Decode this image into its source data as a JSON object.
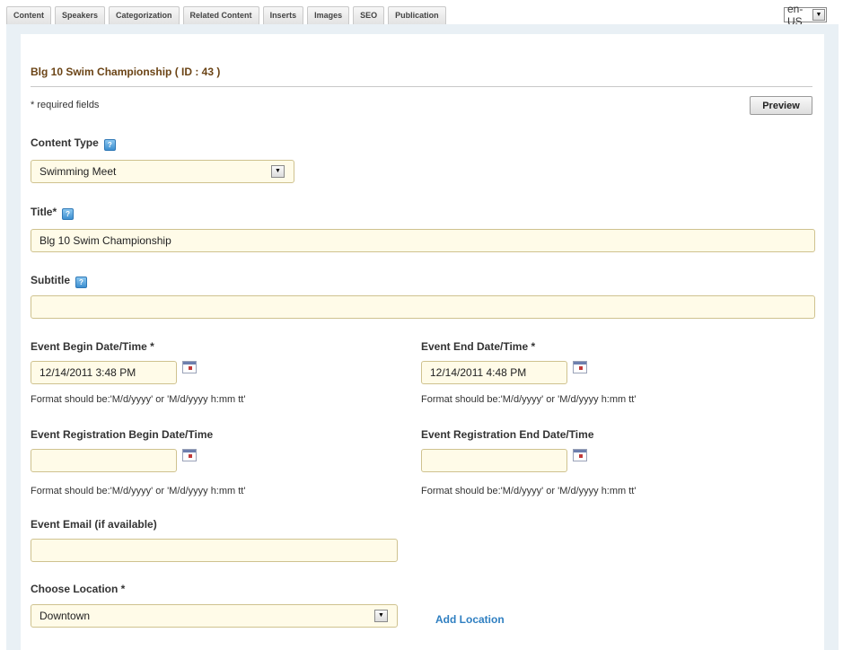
{
  "tabs": [
    "Content",
    "Speakers",
    "Categorization",
    "Related Content",
    "Inserts",
    "Images",
    "SEO",
    "Publication"
  ],
  "language": {
    "selected": "en-US"
  },
  "page": {
    "title": "Blg 10 Swim Championship ( ID : 43 )"
  },
  "required_note": "* required fields",
  "preview_label": "Preview",
  "help_glyph": "?",
  "content_type": {
    "label": "Content Type",
    "value": "Swimming Meet"
  },
  "title_field": {
    "label": "Title*",
    "value": "Blg 10 Swim Championship"
  },
  "subtitle_field": {
    "label": "Subtitle",
    "value": ""
  },
  "event_begin": {
    "label": "Event Begin Date/Time *",
    "value": "12/14/2011 3:48 PM",
    "hint": "Format should be:'M/d/yyyy' or 'M/d/yyyy h:mm tt'"
  },
  "event_end": {
    "label": "Event End Date/Time *",
    "value": "12/14/2011 4:48 PM",
    "hint": "Format should be:'M/d/yyyy' or 'M/d/yyyy h:mm tt'"
  },
  "reg_begin": {
    "label": "Event Registration Begin Date/Time",
    "value": "",
    "hint": "Format should be:'M/d/yyyy' or 'M/d/yyyy h:mm tt'"
  },
  "reg_end": {
    "label": "Event Registration End Date/Time",
    "value": "",
    "hint": "Format should be:'M/d/yyyy' or 'M/d/yyyy h:mm tt'"
  },
  "event_email": {
    "label": "Event Email (if available)",
    "value": ""
  },
  "location": {
    "label": "Choose Location *",
    "value": "Downtown",
    "add_label": "Add Location"
  },
  "dropdown_glyph": "▼",
  "colors": {
    "title": "#6b4416",
    "link": "#2f7fc1",
    "field_bg": "#fffbe8",
    "panel_bg": "#e9f0f5"
  }
}
